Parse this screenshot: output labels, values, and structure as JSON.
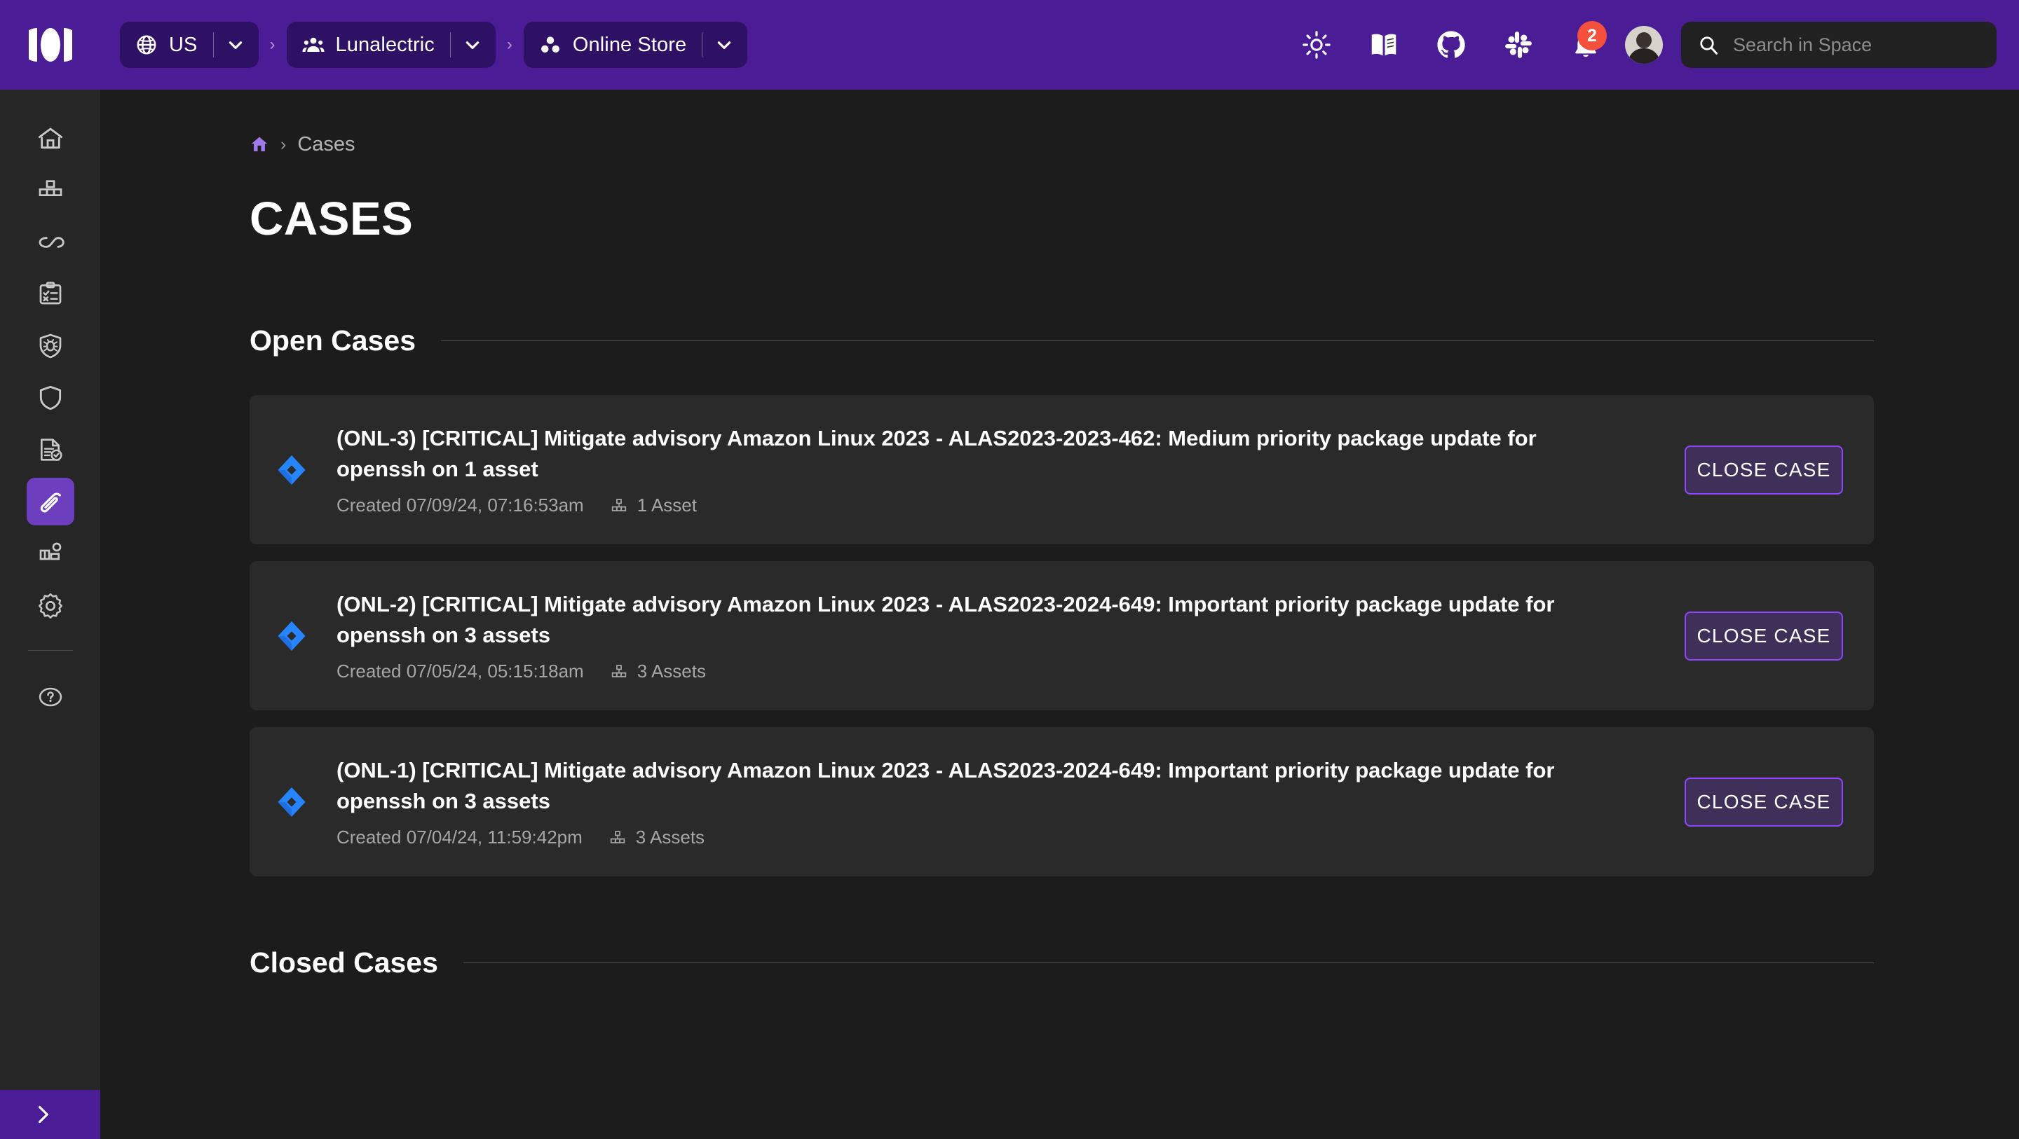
{
  "header": {
    "logo": "modo-logo",
    "chips": [
      {
        "icon": "globe-icon",
        "label": "US",
        "caret": "chevron-down-icon"
      },
      {
        "icon": "people-icon",
        "label": "Lunalectric",
        "caret": "chevron-down-icon"
      },
      {
        "icon": "asana-dots-icon",
        "label": "Online Store",
        "caret": "chevron-down-icon"
      }
    ],
    "separator": "›",
    "actions": [
      {
        "name": "theme-toggle-icon",
        "label": "sun-icon"
      },
      {
        "name": "docs-icon",
        "label": "book-icon"
      },
      {
        "name": "github-icon",
        "label": "github-icon"
      },
      {
        "name": "slack-icon",
        "label": "slack-icon"
      },
      {
        "name": "notifications-icon",
        "label": "bell-icon",
        "badge": "2"
      }
    ],
    "avatar": "user-avatar",
    "search": {
      "placeholder": "Search in Space",
      "icon": "search-icon"
    }
  },
  "sidebar": {
    "items": [
      {
        "name": "sidebar-item-home",
        "icon": "home-icon",
        "active": false
      },
      {
        "name": "sidebar-item-stack",
        "icon": "blocks-icon",
        "active": false
      },
      {
        "name": "sidebar-item-pipelines",
        "icon": "infinity-icon",
        "active": false
      },
      {
        "name": "sidebar-item-tasks",
        "icon": "clipboard-check-icon",
        "active": false
      },
      {
        "name": "sidebar-item-vulnerabilities",
        "icon": "shield-bug-icon",
        "active": false
      },
      {
        "name": "sidebar-item-security",
        "icon": "shield-icon",
        "active": false
      },
      {
        "name": "sidebar-item-compliance",
        "icon": "document-check-icon",
        "active": false
      },
      {
        "name": "sidebar-item-cases",
        "icon": "paperclip-icon",
        "active": true
      },
      {
        "name": "sidebar-item-integrations",
        "icon": "app-grid-icon",
        "active": false
      },
      {
        "name": "sidebar-item-settings",
        "icon": "gear-icon",
        "active": false
      }
    ],
    "help": {
      "name": "sidebar-item-help",
      "icon": "question-circle-icon"
    },
    "collapse": {
      "name": "sidebar-collapse-button",
      "icon": "chevron-right-icon"
    }
  },
  "breadcrumb": {
    "home_icon": "home-icon",
    "separator": "›",
    "current": "Cases"
  },
  "page": {
    "title": "CASES"
  },
  "sections": {
    "open": {
      "title": "Open Cases"
    },
    "closed": {
      "title": "Closed Cases"
    }
  },
  "cases": {
    "open": [
      {
        "icon": "jira-icon",
        "title": "(ONL-3) [CRITICAL] Mitigate advisory Amazon Linux 2023 - ALAS2023-2023-462: Medium priority package update for openssh on 1 asset",
        "created": "Created 07/09/24, 07:16:53am",
        "asset_icon": "assets-stack-icon",
        "assets": "1 Asset",
        "action": "CLOSE CASE"
      },
      {
        "icon": "jira-icon",
        "title": "(ONL-2) [CRITICAL] Mitigate advisory Amazon Linux 2023 - ALAS2023-2024-649: Important priority package update for openssh on 3 assets",
        "created": "Created 07/05/24, 05:15:18am",
        "asset_icon": "assets-stack-icon",
        "assets": "3 Assets",
        "action": "CLOSE CASE"
      },
      {
        "icon": "jira-icon",
        "title": "(ONL-1) [CRITICAL] Mitigate advisory Amazon Linux 2023 - ALAS2023-2024-649: Important priority package update for openssh on 3 assets",
        "created": "Created 07/04/24, 11:59:42pm",
        "asset_icon": "assets-stack-icon",
        "assets": "3 Assets",
        "action": "CLOSE CASE"
      }
    ],
    "closed": []
  },
  "colors": {
    "brand_purple": "#4a1d96",
    "chip_purple": "#2e1065",
    "active_nav": "#6d3fbf",
    "page_bg": "#1c1c1c",
    "card_bg": "#2a2a2a",
    "sidebar_bg": "#262626",
    "button_border": "#9046ff",
    "badge_red": "#f4503c",
    "jira_blue": "#2684ff"
  }
}
